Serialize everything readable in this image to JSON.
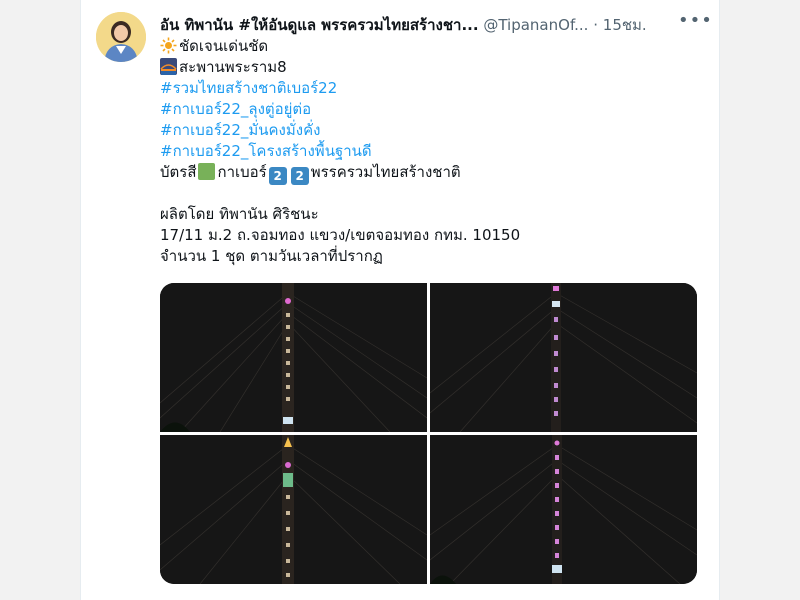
{
  "tweet": {
    "display_name": "อัน ทิพานัน #ให้อันดูแล พรรครวมไทยสร้างชา...",
    "handle": "@TipananOf...",
    "time": "15ชม.",
    "more_icon": "more-icon",
    "lines": {
      "l1": "ชัดเจนเด่นชัด",
      "l2": "สะพานพระราม8",
      "l3": "#รวมไทยสร้างชาติเบอร์22",
      "l4": "#กาเบอร์22_ลุงตู่อยู่ต่อ",
      "l5": "#กาเบอร์22_มั่นคงมั่งคั่ง",
      "l6": "#กาเบอร์22_โครงสร้างพื้นฐานดี",
      "l7a": "บัตรสี",
      "l7b": "กาเบอร์",
      "l7c": "พรรครวมไทยสร้างชาติ",
      "key1": "2",
      "key2": "2",
      "l8": "ผลิตโดย ทิพานัน ศิริชนะ",
      "l9": "17/11 ม.2 ถ.จอมทอง แขวง/เขตจอมทอง กทม. 10150",
      "l10": "จำนวน 1 ชุด ตามวันเวลาที่ปรากฏ"
    },
    "photos": [
      "photo-1",
      "photo-2",
      "photo-3",
      "photo-4"
    ]
  }
}
